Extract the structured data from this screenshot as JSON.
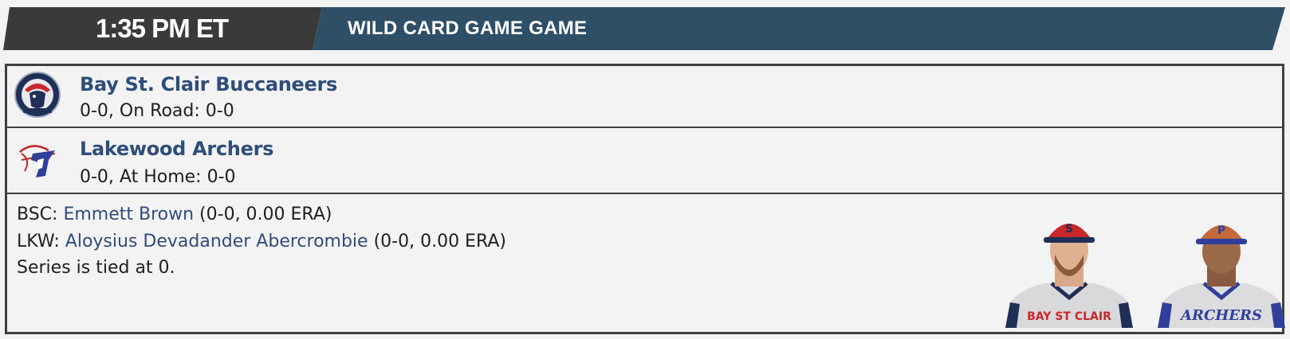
{
  "header": {
    "time": "1:35 PM ET",
    "title": "WILD CARD GAME GAME"
  },
  "teams": [
    {
      "name": "Bay St. Clair Buccaneers",
      "record": "0-0, On Road: 0-0",
      "logo_icon": "buccaneers-logo-icon"
    },
    {
      "name": "Lakewood Archers",
      "record": "0-0, At Home: 0-0",
      "logo_icon": "archers-logo-icon"
    }
  ],
  "pitchers": [
    {
      "abbr": "BSC:",
      "name": "Emmett Brown",
      "stats": "(0-0, 0.00 ERA)"
    },
    {
      "abbr": "LKW:",
      "name": "Aloysius Devadander Abercrombie",
      "stats": "(0-0, 0.00 ERA)"
    }
  ],
  "series_status": "Series is tied at 0.",
  "player_photos": [
    {
      "team": "BSC",
      "jersey_text": "BAY ST CLAIR",
      "cap_color": "#c8282a"
    },
    {
      "team": "LKW",
      "jersey_text": "ARCHERS",
      "cap_color": "#c46a3a"
    }
  ],
  "colors": {
    "time_bg": "#3a3a3a",
    "title_bg": "#2f4f66",
    "link": "#2f4d7a",
    "border": "#3f3f3f",
    "background": "#f3f3f3"
  }
}
